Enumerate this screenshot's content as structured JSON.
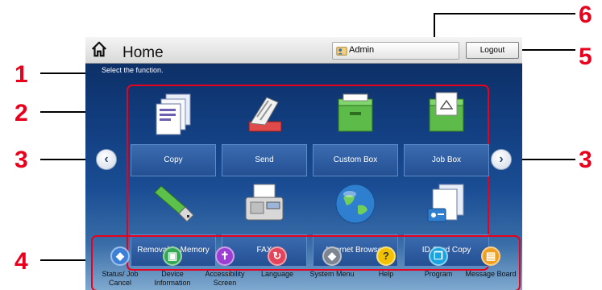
{
  "callouts": [
    "1",
    "2",
    "3",
    "3",
    "4",
    "5",
    "6"
  ],
  "header": {
    "title": "Home",
    "user": "Admin",
    "logout_label": "Logout"
  },
  "instruction": "Select the function.",
  "functions": [
    {
      "label": "Copy"
    },
    {
      "label": "Send"
    },
    {
      "label": "Custom Box"
    },
    {
      "label": "Job Box"
    },
    {
      "label": "Removable Memory"
    },
    {
      "label": "FAX"
    },
    {
      "label": "Internet Browser"
    },
    {
      "label": "ID Card Copy"
    }
  ],
  "system_menu": [
    {
      "label": "Status/ Job Cancel",
      "icon": "status-icon",
      "color": "#3c7fd6"
    },
    {
      "label": "Device Information",
      "icon": "device-info-icon",
      "color": "#34a853"
    },
    {
      "label": "Accessibility Screen",
      "icon": "accessibility-icon",
      "color": "#9a3fd1"
    },
    {
      "label": "Language",
      "icon": "language-icon",
      "color": "#e2455a"
    },
    {
      "label": "System Menu",
      "icon": "system-menu-icon",
      "color": "#7d8590"
    },
    {
      "label": "Help",
      "icon": "help-icon",
      "color": "#f2c200"
    },
    {
      "label": "Program",
      "icon": "program-icon",
      "color": "#1aa4dd"
    },
    {
      "label": "Message Board",
      "icon": "message-board-icon",
      "color": "#f0a020"
    }
  ],
  "colors": {
    "callout": "#e8001c",
    "screen_top": "#0b2a5c",
    "tile_label": "#2f5ea3"
  }
}
